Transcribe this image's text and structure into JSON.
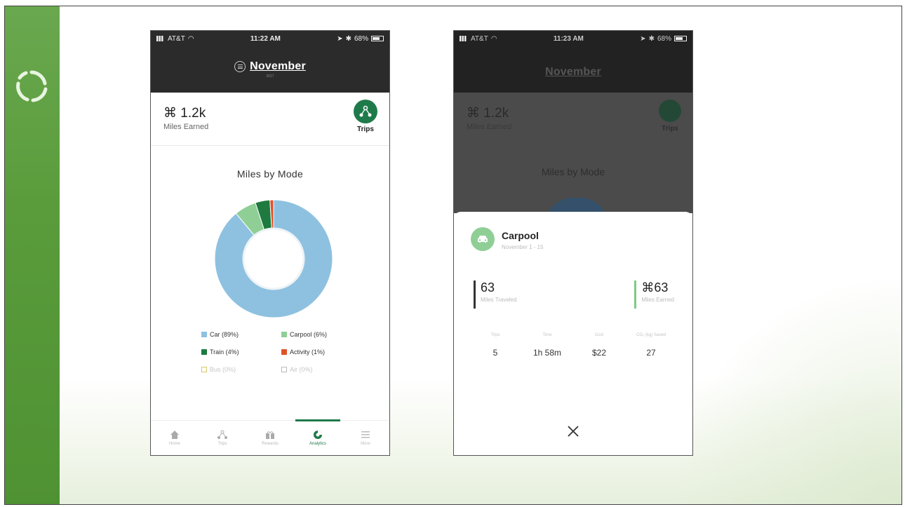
{
  "slide": {
    "colors": {
      "green_bar": "#5a9c3c",
      "brand_green": "#1e7a4a"
    }
  },
  "phone_a": {
    "status": {
      "carrier": "AT&T",
      "time": "11:22 AM",
      "battery": "68%"
    },
    "header": {
      "title": "November",
      "year": "2017"
    },
    "summary": {
      "miles_value": "⌘ 1.2k",
      "miles_label": "Miles Earned",
      "trips_label": "Trips"
    },
    "chart_data": {
      "type": "pie",
      "title": "Miles by Mode",
      "donut": true,
      "slices": [
        {
          "label": "Car (89%)",
          "value": 89,
          "color": "#8ec1e0"
        },
        {
          "label": "Carpool (6%)",
          "value": 6,
          "color": "#8fcf96"
        },
        {
          "label": "Train (4%)",
          "value": 4,
          "color": "#1e7a3e"
        },
        {
          "label": "Activity (1%)",
          "value": 1,
          "color": "#e0522b"
        }
      ],
      "legend_inactive": [
        {
          "label": "Bus (0%)"
        },
        {
          "label": "Air (0%)"
        }
      ]
    },
    "tabs": [
      {
        "label": "Home",
        "active": false
      },
      {
        "label": "Trips",
        "active": false
      },
      {
        "label": "Rewards",
        "active": false
      },
      {
        "label": "Analytics",
        "active": true
      },
      {
        "label": "More",
        "active": false
      }
    ]
  },
  "phone_b": {
    "status": {
      "carrier": "AT&T",
      "time": "11:23 AM",
      "battery": "68%"
    },
    "dim": {
      "title": "November",
      "miles_value": "⌘ 1.2k",
      "miles_label": "Miles Earned",
      "trips_label": "Trips",
      "chart_title": "Miles by Mode"
    },
    "sheet": {
      "mode": "Carpool",
      "date_range": "November 1 - 15",
      "miles_traveled": "63",
      "miles_traveled_label": "Miles Traveled",
      "miles_earned": "⌘63",
      "miles_earned_label": "Miles Earned",
      "metrics": [
        {
          "label": "Trips",
          "value": "5"
        },
        {
          "label": "Time",
          "value": "1h 58m"
        },
        {
          "label": "Cost",
          "value": "$22"
        },
        {
          "label": "CO₂ (kg) Saved",
          "value": "27"
        }
      ]
    }
  }
}
